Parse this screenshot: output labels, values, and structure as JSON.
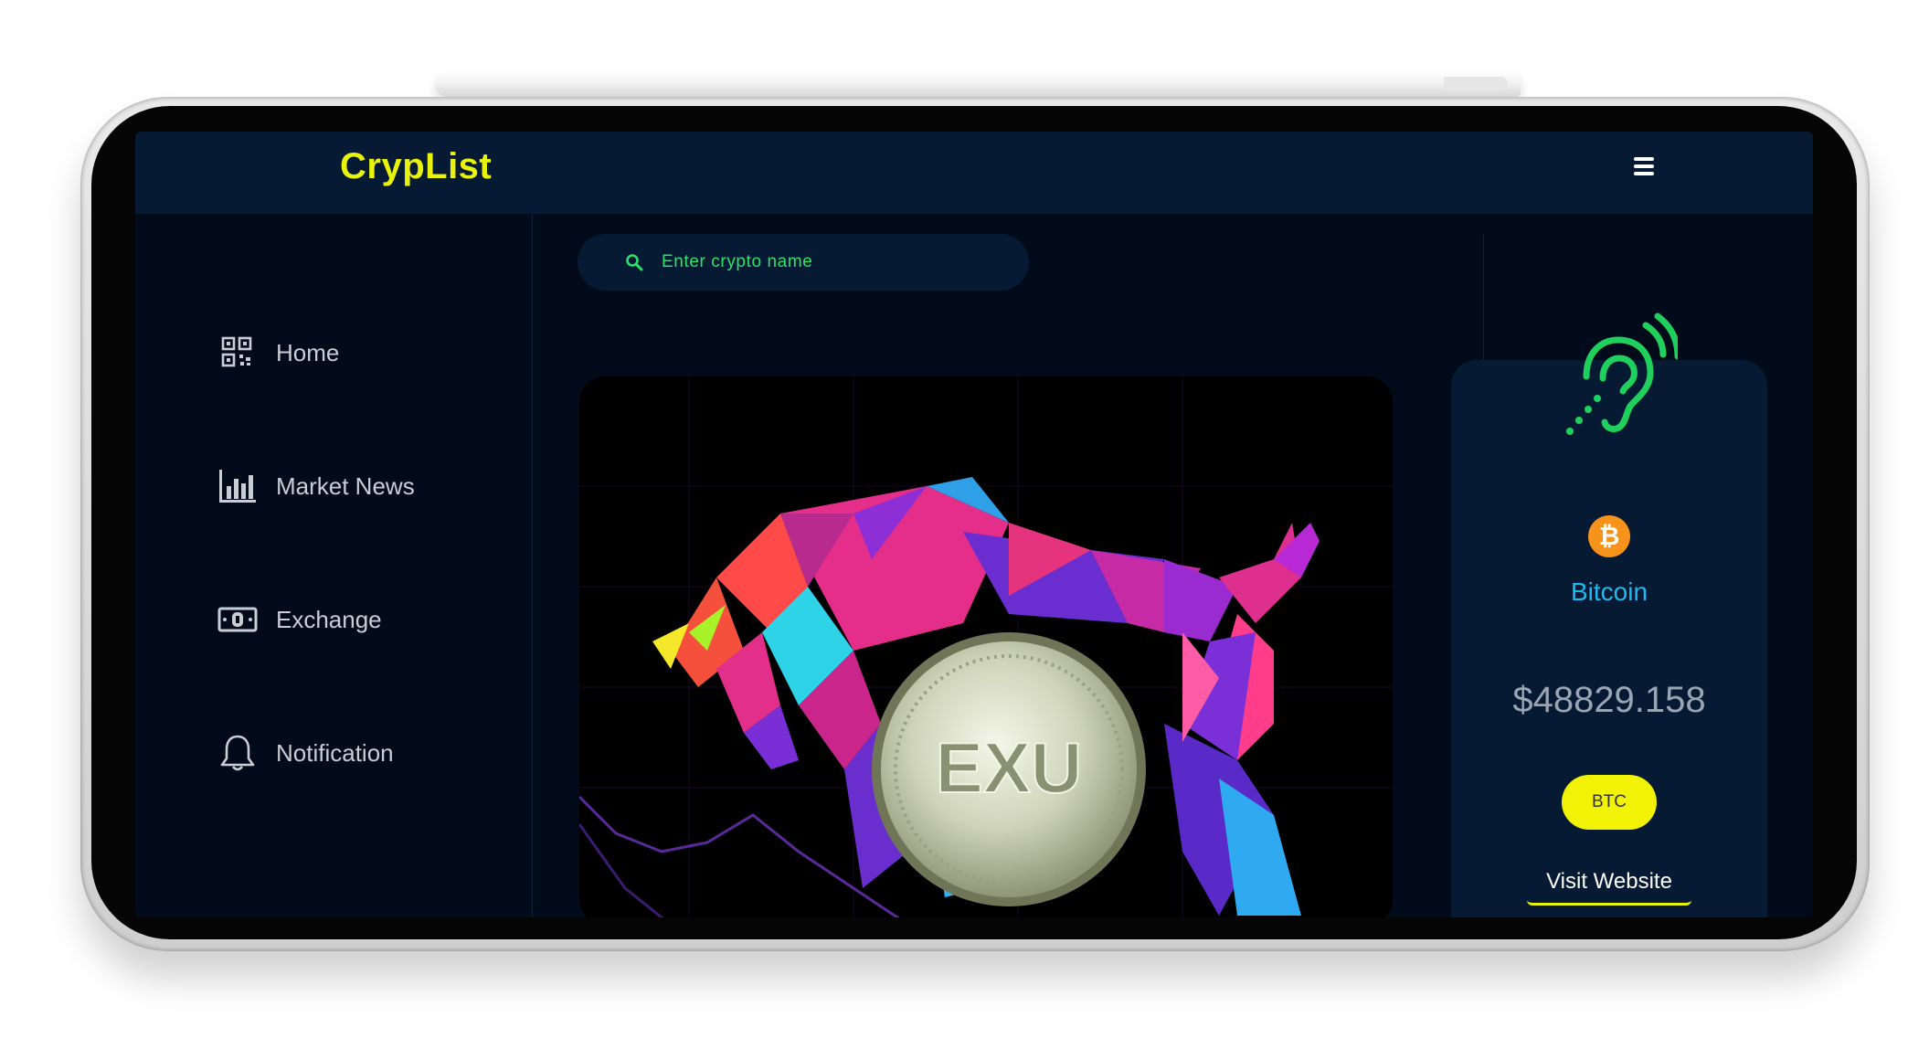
{
  "header": {
    "brand": "CrypList"
  },
  "sidebar": {
    "items": [
      {
        "label": "Home",
        "icon": "qr-code-icon"
      },
      {
        "label": "Market News",
        "icon": "bar-chart-icon"
      },
      {
        "label": "Exchange",
        "icon": "money-bill-icon"
      },
      {
        "label": "Notification",
        "icon": "bell-icon"
      }
    ]
  },
  "search": {
    "placeholder": "Enter crypto name"
  },
  "hero": {
    "coin_text": "EXU"
  },
  "coin_card": {
    "name": "Bitcoin",
    "price": "$48829.158",
    "symbol": "BTC",
    "visit_label": "Visit Website",
    "bitcoin_glyph": "₿"
  },
  "colors": {
    "brand": "#e8f20a",
    "background": "#020b19",
    "panel": "#061b33",
    "search_text": "#2de06a",
    "coin_name": "#20b8f0",
    "btc_orange": "#f7931a",
    "ear_icon": "#1fd15c"
  }
}
